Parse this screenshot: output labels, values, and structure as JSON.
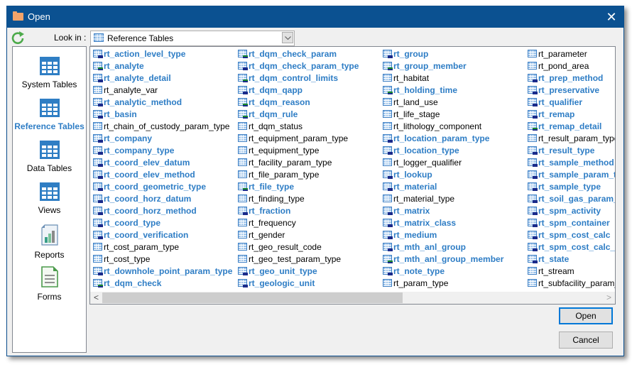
{
  "window": {
    "title": "Open",
    "close_glyph": "✕"
  },
  "lookin": {
    "label": "Look in :",
    "value": "Reference Tables"
  },
  "places": [
    {
      "label": "System Tables",
      "icon": "table-grid-icon",
      "selected": false
    },
    {
      "label": "Reference Tables",
      "icon": "table-grid-icon",
      "selected": true
    },
    {
      "label": "Data Tables",
      "icon": "table-grid-icon",
      "selected": false
    },
    {
      "label": "Views",
      "icon": "table-grid-icon",
      "selected": false
    },
    {
      "label": "Reports",
      "icon": "report-chart-icon",
      "selected": false
    },
    {
      "label": "Forms",
      "icon": "form-document-icon",
      "selected": false
    }
  ],
  "columns": [
    [
      {
        "name": "rt_action_level_type",
        "bold": true,
        "mark": "blue"
      },
      {
        "name": "rt_analyte",
        "bold": true,
        "mark": "green"
      },
      {
        "name": "rt_analyte_detail",
        "bold": true,
        "mark": "blue"
      },
      {
        "name": "rt_analyte_var",
        "bold": false,
        "mark": ""
      },
      {
        "name": "rt_analytic_method",
        "bold": true,
        "mark": "blue"
      },
      {
        "name": "rt_basin",
        "bold": true,
        "mark": "blue"
      },
      {
        "name": "rt_chain_of_custody_param_type",
        "bold": false,
        "mark": ""
      },
      {
        "name": "rt_company",
        "bold": true,
        "mark": "blue"
      },
      {
        "name": "rt_company_type",
        "bold": true,
        "mark": "blue"
      },
      {
        "name": "rt_coord_elev_datum",
        "bold": true,
        "mark": "blue"
      },
      {
        "name": "rt_coord_elev_method",
        "bold": true,
        "mark": "blue"
      },
      {
        "name": "rt_coord_geometric_type",
        "bold": true,
        "mark": "blue"
      },
      {
        "name": "rt_coord_horz_datum",
        "bold": true,
        "mark": "blue"
      },
      {
        "name": "rt_coord_horz_method",
        "bold": true,
        "mark": "blue"
      },
      {
        "name": "rt_coord_type",
        "bold": true,
        "mark": "blue"
      },
      {
        "name": "rt_coord_verification",
        "bold": true,
        "mark": "blue"
      },
      {
        "name": "rt_cost_param_type",
        "bold": false,
        "mark": ""
      },
      {
        "name": "rt_cost_type",
        "bold": false,
        "mark": ""
      },
      {
        "name": "rt_downhole_point_param_type",
        "bold": true,
        "mark": "blue"
      },
      {
        "name": "rt_dqm_check",
        "bold": true,
        "mark": "green"
      }
    ],
    [
      {
        "name": "rt_dqm_check_param",
        "bold": true,
        "mark": "green"
      },
      {
        "name": "rt_dqm_check_param_type",
        "bold": true,
        "mark": "blue"
      },
      {
        "name": "rt_dqm_control_limits",
        "bold": true,
        "mark": "green"
      },
      {
        "name": "rt_dqm_qapp",
        "bold": true,
        "mark": "blue"
      },
      {
        "name": "rt_dqm_reason",
        "bold": true,
        "mark": "green"
      },
      {
        "name": "rt_dqm_rule",
        "bold": true,
        "mark": "green"
      },
      {
        "name": "rt_dqm_status",
        "bold": false,
        "mark": ""
      },
      {
        "name": "rt_equipment_param_type",
        "bold": false,
        "mark": ""
      },
      {
        "name": "rt_equipment_type",
        "bold": false,
        "mark": ""
      },
      {
        "name": "rt_facility_param_type",
        "bold": false,
        "mark": ""
      },
      {
        "name": "rt_file_param_type",
        "bold": false,
        "mark": ""
      },
      {
        "name": "rt_file_type",
        "bold": true,
        "mark": "green"
      },
      {
        "name": "rt_finding_type",
        "bold": false,
        "mark": ""
      },
      {
        "name": "rt_fraction",
        "bold": true,
        "mark": "blue"
      },
      {
        "name": "rt_frequency",
        "bold": false,
        "mark": ""
      },
      {
        "name": "rt_gender",
        "bold": false,
        "mark": ""
      },
      {
        "name": "rt_geo_result_code",
        "bold": false,
        "mark": ""
      },
      {
        "name": "rt_geo_test_param_type",
        "bold": false,
        "mark": ""
      },
      {
        "name": "rt_geo_unit_type",
        "bold": true,
        "mark": "blue"
      },
      {
        "name": "rt_geologic_unit",
        "bold": true,
        "mark": "blue"
      }
    ],
    [
      {
        "name": "rt_group",
        "bold": true,
        "mark": "blue"
      },
      {
        "name": "rt_group_member",
        "bold": true,
        "mark": "green"
      },
      {
        "name": "rt_habitat",
        "bold": false,
        "mark": ""
      },
      {
        "name": "rt_holding_time",
        "bold": true,
        "mark": "green"
      },
      {
        "name": "rt_land_use",
        "bold": false,
        "mark": ""
      },
      {
        "name": "rt_life_stage",
        "bold": false,
        "mark": ""
      },
      {
        "name": "rt_lithology_component",
        "bold": false,
        "mark": ""
      },
      {
        "name": "rt_location_param_type",
        "bold": true,
        "mark": "blue"
      },
      {
        "name": "rt_location_type",
        "bold": true,
        "mark": "blue"
      },
      {
        "name": "rt_logger_qualifier",
        "bold": false,
        "mark": ""
      },
      {
        "name": "rt_lookup",
        "bold": true,
        "mark": "blue"
      },
      {
        "name": "rt_material",
        "bold": true,
        "mark": "blue"
      },
      {
        "name": "rt_material_type",
        "bold": false,
        "mark": ""
      },
      {
        "name": "rt_matrix",
        "bold": true,
        "mark": "blue"
      },
      {
        "name": "rt_matrix_class",
        "bold": true,
        "mark": "blue"
      },
      {
        "name": "rt_medium",
        "bold": true,
        "mark": "blue"
      },
      {
        "name": "rt_mth_anl_group",
        "bold": true,
        "mark": "blue"
      },
      {
        "name": "rt_mth_anl_group_member",
        "bold": true,
        "mark": "green"
      },
      {
        "name": "rt_note_type",
        "bold": true,
        "mark": "blue"
      },
      {
        "name": "rt_param_type",
        "bold": false,
        "mark": ""
      }
    ],
    [
      {
        "name": "rt_parameter",
        "bold": false,
        "mark": ""
      },
      {
        "name": "rt_pond_area",
        "bold": false,
        "mark": ""
      },
      {
        "name": "rt_prep_method",
        "bold": true,
        "mark": "blue"
      },
      {
        "name": "rt_preservative",
        "bold": true,
        "mark": "blue"
      },
      {
        "name": "rt_qualifier",
        "bold": true,
        "mark": "blue"
      },
      {
        "name": "rt_remap",
        "bold": true,
        "mark": "blue"
      },
      {
        "name": "rt_remap_detail",
        "bold": true,
        "mark": "green"
      },
      {
        "name": "rt_result_param_type",
        "bold": false,
        "mark": ""
      },
      {
        "name": "rt_result_type",
        "bold": true,
        "mark": "blue"
      },
      {
        "name": "rt_sample_method",
        "bold": true,
        "mark": "blue"
      },
      {
        "name": "rt_sample_param_t",
        "bold": true,
        "mark": "blue"
      },
      {
        "name": "rt_sample_type",
        "bold": true,
        "mark": "blue"
      },
      {
        "name": "rt_soil_gas_param_",
        "bold": true,
        "mark": "blue"
      },
      {
        "name": "rt_spm_activity",
        "bold": true,
        "mark": "blue"
      },
      {
        "name": "rt_spm_container",
        "bold": true,
        "mark": "blue"
      },
      {
        "name": "rt_spm_cost_calc",
        "bold": true,
        "mark": "blue"
      },
      {
        "name": "rt_spm_cost_calc_",
        "bold": true,
        "mark": "blue"
      },
      {
        "name": "rt_state",
        "bold": true,
        "mark": "blue"
      },
      {
        "name": "rt_stream",
        "bold": false,
        "mark": ""
      },
      {
        "name": "rt_subfacility_param_t",
        "bold": false,
        "mark": ""
      }
    ]
  ],
  "scrollbar": {
    "left_glyph": "<",
    "right_glyph": ">",
    "position_fraction": 0.0,
    "visible_fraction": 0.6
  },
  "buttons": {
    "open": "Open",
    "cancel": "Cancel"
  },
  "colors": {
    "titlebar": "#0b5191",
    "selected_place": "#2e7dc5",
    "bold_item": "#2e7dc5",
    "default_button_border": "#0078d7"
  }
}
